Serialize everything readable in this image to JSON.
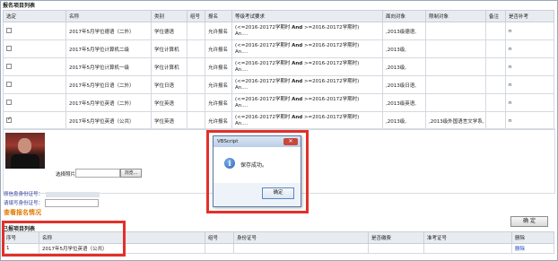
{
  "registration_list": {
    "title": "报名项目列表",
    "columns": [
      "选定",
      "名称",
      "类别",
      "组号",
      "报名",
      "等级考试要求",
      "面向对象",
      "限制对象",
      "备注",
      "是否补考"
    ],
    "rows": [
      {
        "checked": false,
        "name": "2017年5月学位德语（二外）",
        "category": "学位德语",
        "group": "",
        "status": "允许报名",
        "req_a": "(<=2016-20172学期时",
        "req_and": "And",
        "req_b": ">=2016-20172学期时)",
        "req_c": "An....",
        "target": ",2013级德语,",
        "restrict": "",
        "note": "",
        "makeup": "n"
      },
      {
        "checked": false,
        "name": "2017年5月学位计算机二级",
        "category": "学位计算机",
        "group": "",
        "status": "允许报名",
        "req_a": "(<=2016-20172学期时",
        "req_and": "And",
        "req_b": ">=2016-20172学期时)",
        "req_c": "An....",
        "target": ",2013级,",
        "restrict": "",
        "note": "",
        "makeup": "n"
      },
      {
        "checked": false,
        "name": "2017年5月学位计算机一级",
        "category": "学位计算机",
        "group": "",
        "status": "允许报名",
        "req_a": "(<=2016-20172学期时",
        "req_and": "And",
        "req_b": ">=2016-20172学期时)",
        "req_c": "An....",
        "target": ",2013级,",
        "restrict": "",
        "note": "",
        "makeup": "n"
      },
      {
        "checked": false,
        "name": "2017年5月学位日语（二外）",
        "category": "学位日语",
        "group": "",
        "status": "允许报名",
        "req_a": "(<=2016-20172学期时",
        "req_and": "And",
        "req_b": ">=2016-20172学期时)",
        "req_c": "An....",
        "target": ",2013级日语,",
        "restrict": "",
        "note": "",
        "makeup": "n"
      },
      {
        "checked": false,
        "name": "2017年5月学位英语（二外）",
        "category": "学位英语",
        "group": "",
        "status": "允许报名",
        "req_a": "(<=2016-20172学期时",
        "req_and": "And",
        "req_b": ">=2016-20172学期时)",
        "req_c": "An....",
        "target": ",2013级英语,",
        "restrict": "",
        "note": "",
        "makeup": "n"
      },
      {
        "checked": true,
        "name": "2017年5月学位英语（公共）",
        "category": "学位英语",
        "group": "",
        "status": "允许报名",
        "req_a": "(<=2016-20172学期时",
        "req_and": "And",
        "req_b": ">=2016-20172学期时)",
        "req_c": "An....",
        "target": ",2013级,",
        "restrict": ",2013级外国语言文学系,",
        "note": "",
        "makeup": "n"
      }
    ]
  },
  "photo_upload": {
    "label": "选择照片",
    "browse_label": "浏览..."
  },
  "identity": {
    "orig_id_label": "原信息身份证号：",
    "new_id_label": "请填写身份证号："
  },
  "check_link": "查看报名情况",
  "confirm_button": "确  定",
  "dialog": {
    "title": "VBScript",
    "close": "✕",
    "icon": "i",
    "message": "保存成功。",
    "ok": "确定"
  },
  "registered_list": {
    "title": "已报项目列表",
    "columns": [
      "序号",
      "名称",
      "组号",
      "身份证号",
      "是否缴费",
      "准考证号",
      "删除"
    ],
    "rows": [
      {
        "index": "1",
        "name": "2017年5月学位英语（公共）",
        "group": "",
        "id": "",
        "paid": "",
        "ticket": "",
        "delete": "删除"
      }
    ]
  },
  "colors": {
    "highlight": "#e2302a",
    "link": "#2244bb",
    "check_link": "#e07a00"
  }
}
